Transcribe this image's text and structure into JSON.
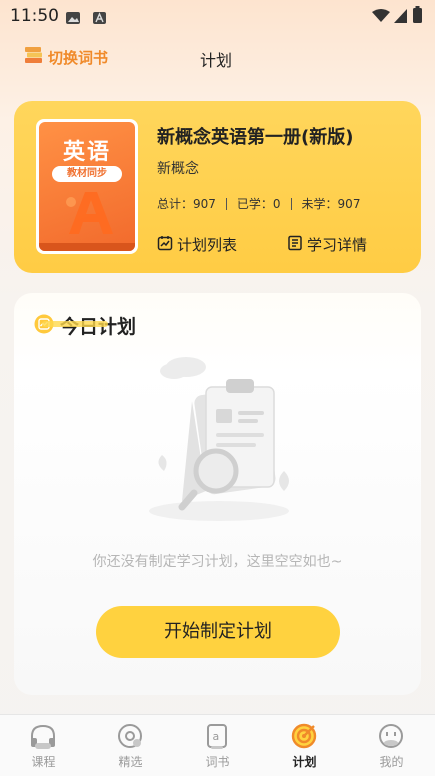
{
  "status_bar": {
    "time": "11:50"
  },
  "header": {
    "switch_label": "切换词书",
    "title": "计划"
  },
  "book": {
    "cover_title": "英语",
    "cover_tag": "教材同步",
    "title": "新概念英语第一册(新版)",
    "publisher": "新概念",
    "stats": {
      "total": "总计：907",
      "learned": "已学：0",
      "unlearned": "未学：907"
    },
    "plan_list_label": "计划列表",
    "study_detail_label": "学习详情"
  },
  "plan": {
    "title": "今日计划",
    "empty_text": "你还没有制定学习计划，这里空空如也~",
    "start_button": "开始制定计划"
  },
  "nav": [
    {
      "label": "课程",
      "icon": "headphones-icon"
    },
    {
      "label": "精选",
      "icon": "disc-icon"
    },
    {
      "label": "词书",
      "icon": "book-icon"
    },
    {
      "label": "计划",
      "icon": "target-icon"
    },
    {
      "label": "我的",
      "icon": "face-icon"
    }
  ],
  "colors": {
    "accent": "#ffcc44",
    "brand_orange": "#f08a2a",
    "active_nav": "#f08a2a"
  }
}
